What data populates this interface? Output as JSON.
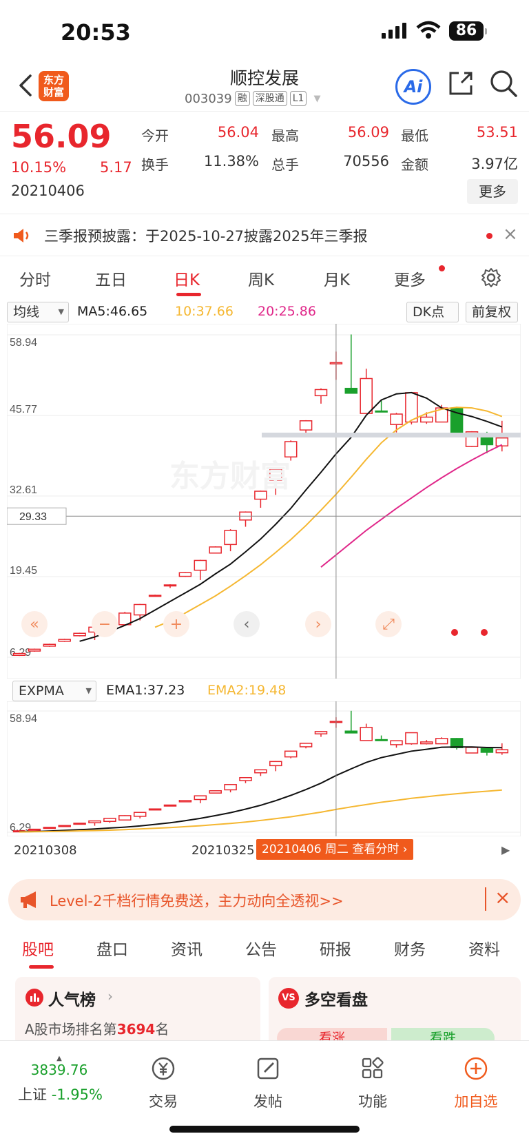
{
  "status_bar": {
    "time": "20:53",
    "battery": "86"
  },
  "nav": {
    "logo_text": "东方财富",
    "stock_name": "顺控发展",
    "stock_code": "003039",
    "tags": [
      "融",
      "深股通",
      "L1"
    ]
  },
  "quote": {
    "price": "56.09",
    "change_pct": "10.15%",
    "change_amt": "5.17",
    "date": "20210406",
    "fields": [
      {
        "label": "今开",
        "value": "56.04",
        "color": "red"
      },
      {
        "label": "最高",
        "value": "56.09",
        "color": "red"
      },
      {
        "label": "最低",
        "value": "53.51",
        "color": "red"
      },
      {
        "label": "换手",
        "value": "11.38%",
        "color": "dark"
      },
      {
        "label": "总手",
        "value": "70556",
        "color": "dark"
      },
      {
        "label": "金额",
        "value": "3.97亿",
        "color": "dark"
      }
    ],
    "more_label": "更多"
  },
  "notice": {
    "text": "三季报预披露：于2025-10-27披露2025年三季报"
  },
  "chart_tabs": [
    "分时",
    "五日",
    "日K",
    "周K",
    "月K",
    "更多"
  ],
  "chart_tab_active": "日K",
  "indicator_bar": {
    "select": "均线",
    "ma5": "MA5:46.65",
    "ma10": "10:37.66",
    "ma20": "20:25.86",
    "dk_label": "DK点",
    "adjust_label": "前复权"
  },
  "indicator_bar2": {
    "select": "EXPMA",
    "ema1": "EMA1:37.23",
    "ema2": "EMA2:19.48"
  },
  "chart_data": [
    {
      "type": "candlestick",
      "title": "",
      "y_ticks": [
        "58.94",
        "45.77",
        "32.61",
        "19.45",
        "6.29"
      ],
      "ylim": [
        6.29,
        58.94
      ],
      "crosshair_value": "29.33",
      "candles": [
        {
          "o": 6.6,
          "c": 6.9,
          "h": 7.0,
          "l": 6.5
        },
        {
          "o": 7.3,
          "c": 7.6,
          "h": 7.7,
          "l": 7.2
        },
        {
          "o": 8.1,
          "c": 8.4,
          "h": 8.5,
          "l": 8.0
        },
        {
          "o": 8.9,
          "c": 9.2,
          "h": 9.3,
          "l": 8.8
        },
        {
          "o": 9.8,
          "c": 10.2,
          "h": 10.3,
          "l": 9.7
        },
        {
          "o": 10.4,
          "c": 11.2,
          "h": 11.3,
          "l": 9.1
        },
        {
          "o": 11.0,
          "c": 12.3,
          "h": 12.5,
          "l": 10.4
        },
        {
          "o": 11.6,
          "c": 13.5,
          "h": 13.7,
          "l": 11.4
        },
        {
          "o": 13.2,
          "c": 14.9,
          "h": 15.0,
          "l": 12.3
        },
        {
          "o": 16.3,
          "c": 16.4,
          "h": 16.5,
          "l": 16.3
        },
        {
          "o": 18.0,
          "c": 18.1,
          "h": 18.2,
          "l": 17.6
        },
        {
          "o": 19.5,
          "c": 20.1,
          "h": 20.2,
          "l": 19.4
        },
        {
          "o": 20.5,
          "c": 22.1,
          "h": 22.2,
          "l": 18.9
        },
        {
          "o": 23.3,
          "c": 24.3,
          "h": 24.4,
          "l": 23.3
        },
        {
          "o": 24.7,
          "c": 27.0,
          "h": 27.2,
          "l": 23.6
        },
        {
          "o": 28.7,
          "c": 30.0,
          "h": 30.1,
          "l": 27.6
        },
        {
          "o": 32.1,
          "c": 33.4,
          "h": 33.5,
          "l": 30.7
        },
        {
          "o": 35.2,
          "c": 37.0,
          "h": 37.2,
          "l": 32.8
        },
        {
          "o": 39.0,
          "c": 41.5,
          "h": 41.7,
          "l": 38.4
        },
        {
          "o": 43.4,
          "c": 44.9,
          "h": 45.0,
          "l": 42.7
        },
        {
          "o": 49.0,
          "c": 50.0,
          "h": 50.2,
          "l": 47.7
        },
        {
          "o": 54.2,
          "c": 54.4,
          "h": 56.2,
          "l": 51.6
        },
        {
          "o": 50.2,
          "c": 49.4,
          "h": 59.0,
          "l": 49.4
        },
        {
          "o": 46.1,
          "c": 51.8,
          "h": 53.4,
          "l": 46.1
        },
        {
          "o": 46.5,
          "c": 46.4,
          "h": 48.3,
          "l": 46.4
        },
        {
          "o": 44.3,
          "c": 46.0,
          "h": 46.2,
          "l": 43.0
        },
        {
          "o": 44.7,
          "c": 49.5,
          "h": 49.6,
          "l": 44.3
        },
        {
          "o": 44.7,
          "c": 45.5,
          "h": 46.3,
          "l": 44.4
        },
        {
          "o": 44.7,
          "c": 47.0,
          "h": 47.5,
          "l": 44.7
        },
        {
          "o": 47.0,
          "c": 43.0,
          "h": 47.2,
          "l": 42.2
        },
        {
          "o": 40.7,
          "c": 43.1,
          "h": 43.2,
          "l": 40.6
        },
        {
          "o": 42.6,
          "c": 41.0,
          "h": 43.1,
          "l": 39.6
        },
        {
          "o": 40.8,
          "c": 42.1,
          "h": 44.9,
          "l": 39.9
        }
      ],
      "ma_series": [
        {
          "name": "MA5",
          "color": "#111111",
          "values": [
            null,
            null,
            null,
            null,
            8.9,
            9.6,
            10.5,
            11.5,
            12.6,
            14.0,
            15.4,
            16.8,
            18.2,
            19.9,
            21.5,
            23.5,
            25.6,
            28.0,
            30.6,
            33.6,
            36.5,
            39.5,
            42.2,
            45.8,
            48.3,
            49.3,
            49.5,
            48.6,
            47.0,
            46.2,
            45.6,
            44.8,
            43.9
          ]
        },
        {
          "name": "MA10",
          "color": "#f5b731",
          "values": [
            null,
            null,
            null,
            null,
            null,
            null,
            null,
            null,
            null,
            11.2,
            12.2,
            13.5,
            14.9,
            16.3,
            17.9,
            19.6,
            21.4,
            23.4,
            25.5,
            27.8,
            30.3,
            32.9,
            35.7,
            38.6,
            41.3,
            43.4,
            45.0,
            46.1,
            46.8,
            47.1,
            47.0,
            46.5,
            45.6
          ]
        },
        {
          "name": "MA20",
          "color": "#e0288a",
          "values": [
            null,
            null,
            null,
            null,
            null,
            null,
            null,
            null,
            null,
            null,
            null,
            null,
            null,
            null,
            null,
            null,
            null,
            null,
            null,
            null,
            21.0,
            23.0,
            25.0,
            27.0,
            28.8,
            30.6,
            32.3,
            34.0,
            35.6,
            37.1,
            38.5,
            39.8,
            41.0
          ]
        }
      ]
    },
    {
      "type": "candlestick",
      "title": "",
      "y_ticks": [
        "58.94",
        "6.29"
      ],
      "ylim": [
        6.29,
        58.94
      ],
      "ema_series": [
        {
          "name": "EMA1",
          "color": "#111111",
          "values": [
            6.5,
            6.6,
            6.8,
            7.1,
            7.4,
            7.7,
            8.1,
            8.5,
            9.0,
            9.7,
            10.4,
            11.3,
            12.3,
            13.5,
            14.8,
            16.3,
            18.0,
            20.0,
            22.3,
            24.8,
            27.6,
            30.9,
            33.8,
            36.6,
            38.7,
            40.1,
            41.5,
            42.3,
            43.2,
            43.3,
            43.3,
            43.1,
            43.0
          ]
        },
        {
          "name": "EMA2",
          "color": "#f5b731",
          "values": [
            6.4,
            6.5,
            6.6,
            6.7,
            6.9,
            7.0,
            7.2,
            7.4,
            7.7,
            8.0,
            8.3,
            8.7,
            9.1,
            9.6,
            10.1,
            10.7,
            11.4,
            12.2,
            13.0,
            14.0,
            15.0,
            16.2,
            17.3,
            18.3,
            19.3,
            20.1,
            21.0,
            21.7,
            22.4,
            23.0,
            23.6,
            24.1,
            24.6
          ]
        }
      ],
      "x_ticks": [
        "20210308",
        "20210325"
      ],
      "crosshair_label": "20210406 周二 查看分时"
    }
  ],
  "chart_controls": [
    "«",
    "−",
    "+",
    "‹",
    "›",
    "⤢"
  ],
  "banner": {
    "text": "Level-2千档行情免费送，主力动向全透视>>"
  },
  "bottom_tabs": [
    "股吧",
    "盘口",
    "资讯",
    "公告",
    "研报",
    "财务",
    "资料"
  ],
  "cards": {
    "popularity_title": "人气榜",
    "popularity_rank_prefix": "A股市场排名第",
    "popularity_rank": "3694",
    "popularity_rank_suffix": "名",
    "bullbear_title": "多空看盘",
    "bull_label": "看涨",
    "bear_label": "看跌"
  },
  "tab_bar": {
    "index_value": "3839.76",
    "index_name": "上证",
    "index_change": "-1.95%",
    "items": [
      "交易",
      "发帖",
      "功能",
      "加自选"
    ]
  },
  "colors": {
    "up": "#e8262d",
    "down": "#1aa02c",
    "accent": "#f05a1c"
  }
}
